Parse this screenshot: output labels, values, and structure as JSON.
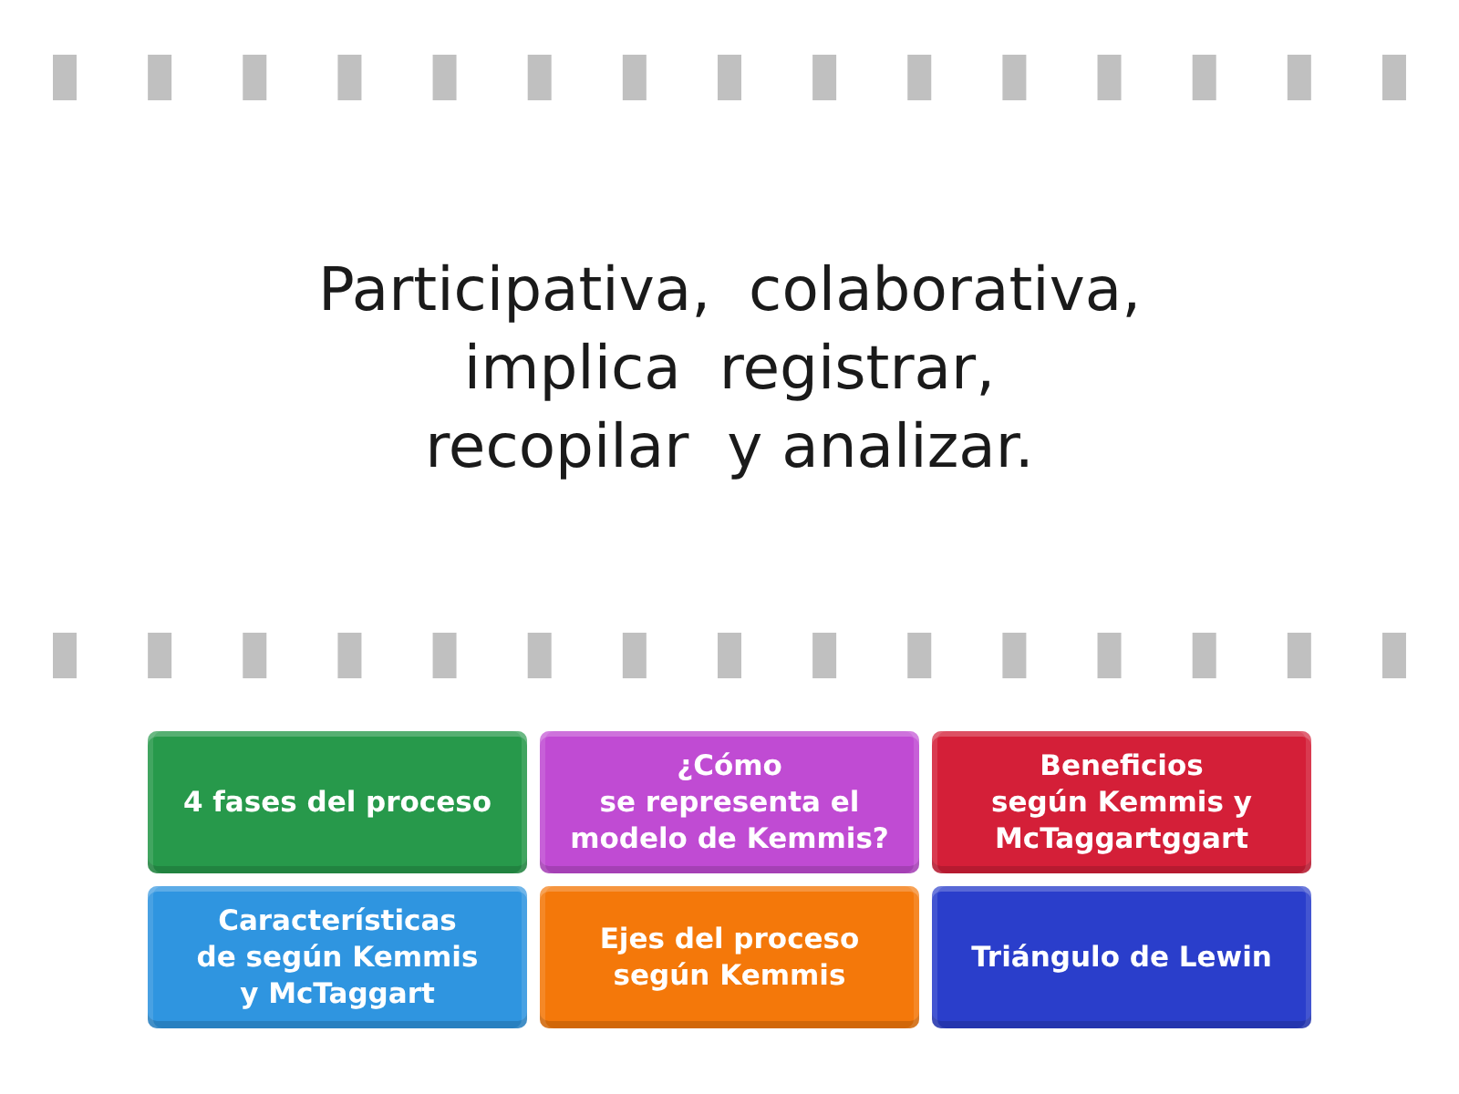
{
  "prompt": {
    "text": "Participativa,  colaborativa,\nimplica  registrar,\nrecopilar  y analizar."
  },
  "answers": [
    {
      "label": "4 fases del proceso",
      "color": "#27994b"
    },
    {
      "label": "¿Cómo\nse representa el\nmodelo de Kemmis?",
      "color": "#c04bd3"
    },
    {
      "label": "Beneficios\nsegún Kemmis y\nMcTaggartggart",
      "color": "#d41f38"
    },
    {
      "label": "Características\nde según Kemmis\ny McTaggart",
      "color": "#2f95e0"
    },
    {
      "label": "Ejes del proceso\nsegún Kemmis",
      "color": "#f4780a"
    },
    {
      "label": "Triángulo de Lewin",
      "color": "#2a3ecb"
    }
  ]
}
